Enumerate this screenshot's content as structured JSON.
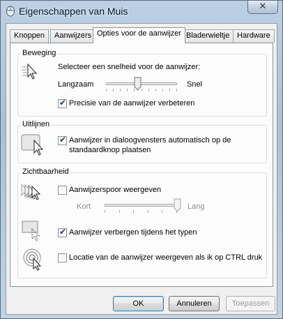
{
  "window": {
    "title": "Eigenschappen van Muis",
    "close_label": "✕"
  },
  "tabs": [
    {
      "label": "Knoppen",
      "active": false
    },
    {
      "label": "Aanwijzers",
      "active": false
    },
    {
      "label": "Opties voor de aanwijzer",
      "active": true
    },
    {
      "label": "Bladerwieltje",
      "active": false
    },
    {
      "label": "Hardware",
      "active": false
    }
  ],
  "beweging": {
    "heading": "Beweging",
    "speed_prompt": "Selecteer een snelheid voor de aanwijzer:",
    "slow_label": "Langzaam",
    "fast_label": "Snel",
    "speed_level": 0.45,
    "precision_label": "Precisie van de aanwijzer verbeteren",
    "precision_checked": true
  },
  "uitlijnen": {
    "heading": "Uitlijnen",
    "snap_label_line1": "Aanwijzer in dialoogvensters automatisch op de",
    "snap_label_line2": "standaardknop plaatsen",
    "snap_checked": true
  },
  "zichtbaarheid": {
    "heading": "Zichtbaarheid",
    "trails_label": "Aanwijzerspoor weergeven",
    "trails_checked": false,
    "short_label": "Kort",
    "long_label": "Lang",
    "trails_level": 1.0,
    "hide_label": "Aanwijzer verbergen tijdens het typen",
    "hide_checked": true,
    "ctrl_label": "Locatie van de aanwijzer weergeven als ik op CTRL druk",
    "ctrl_checked": false
  },
  "buttons": {
    "ok": "OK",
    "cancel": "Annuleren",
    "apply": "Toepassen"
  }
}
